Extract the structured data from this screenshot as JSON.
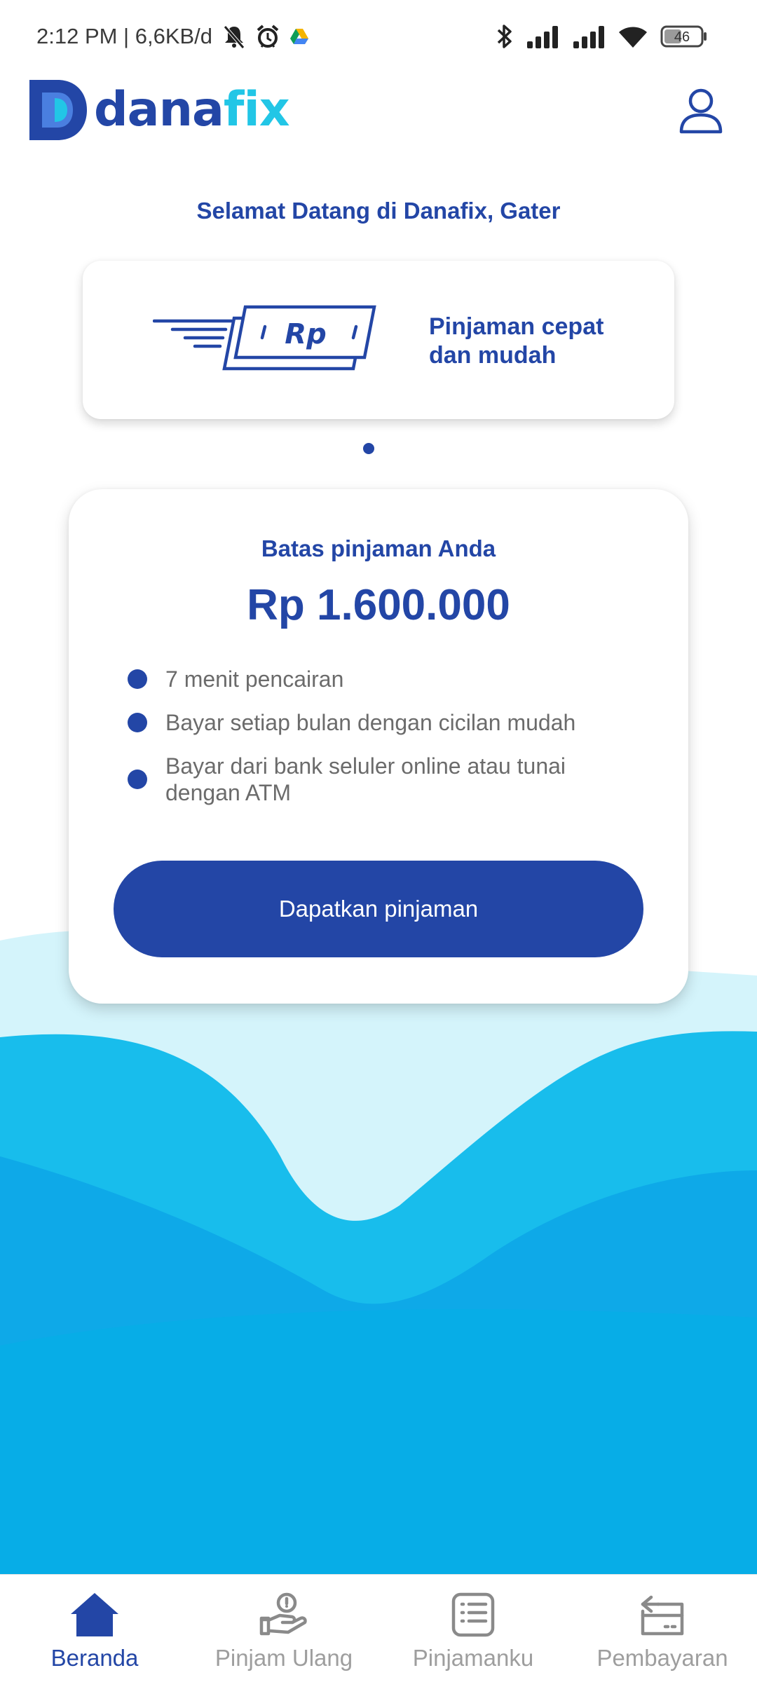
{
  "status_bar": {
    "time_and_speed": "2:12 PM | 6,6KB/d",
    "battery": "46"
  },
  "header": {
    "logo_part1": "dana",
    "logo_part2": "fix"
  },
  "welcome_text": "Selamat Datang di Danafix, Gater",
  "banner": {
    "illustration_text": "Rp",
    "text": "Pinjaman cepat dan mudah"
  },
  "loan_card": {
    "label": "Batas pinjaman Anda",
    "amount": "Rp 1.600.000",
    "features": [
      "7 menit pencairan",
      "Bayar setiap bulan dengan cicilan mudah",
      "Bayar dari bank seluler online atau tunai dengan ATM"
    ],
    "cta": "Dapatkan pinjaman"
  },
  "bottom_nav": {
    "items": [
      {
        "label": "Beranda",
        "icon": "home-icon",
        "active": true
      },
      {
        "label": "Pinjam Ulang",
        "icon": "hand-coin-icon",
        "active": false
      },
      {
        "label": "Pinjamanku",
        "icon": "list-icon",
        "active": false
      },
      {
        "label": "Pembayaran",
        "icon": "card-icon",
        "active": false
      }
    ]
  },
  "colors": {
    "primary": "#2346a6",
    "accent": "#22c6e6",
    "inactive": "#9e9e9e",
    "wave_light": "#d4f4fb",
    "wave_mid": "#18bdec",
    "wave_dark": "#0aa8e6"
  }
}
